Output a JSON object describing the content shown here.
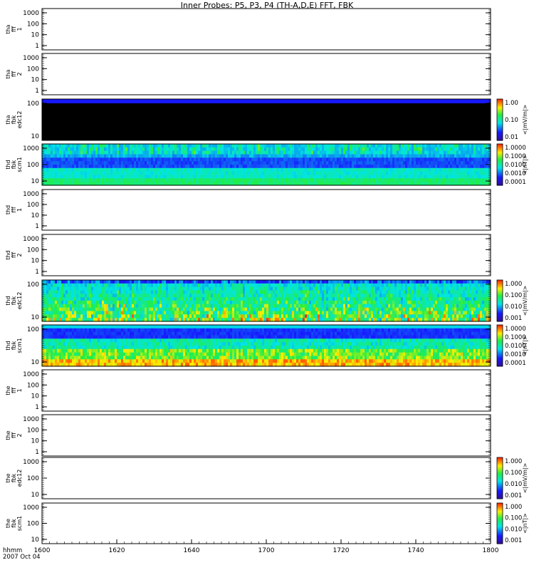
{
  "page": {
    "title": "Inner Probes: P5, P3, P4 (TH-A,D,E) FFT, FBK",
    "time_label": "hhmm",
    "date_label": "2007 Oct 04"
  },
  "colors": {
    "low": "#1818ff",
    "mid": "#00e5e5",
    "midhigh": "#22ee44",
    "high": "#ffee00",
    "peak": "#ff2a00",
    "black": "#000000"
  },
  "chart_data": [
    {
      "type": "heatmap",
      "ylabel": [
        "tha",
        "fff",
        "1"
      ],
      "yticks": [
        "1000",
        "100",
        "10",
        "1"
      ],
      "yscale": "log",
      "state": "empty"
    },
    {
      "type": "heatmap",
      "ylabel": [
        "tha",
        "fff",
        "2"
      ],
      "yticks": [
        "1000",
        "100",
        "10",
        "1"
      ],
      "yscale": "log",
      "state": "empty"
    },
    {
      "type": "heatmap",
      "ylabel": [
        "tha",
        "fbk",
        "edc12"
      ],
      "yticks": [
        "100",
        "10"
      ],
      "yscale": "log",
      "colorbar": {
        "ticks": [
          "1.00",
          "0.10",
          "0.01"
        ],
        "unit": "<|mV/m|>"
      },
      "state": "mostly-black",
      "top_band": "low"
    },
    {
      "type": "heatmap",
      "ylabel": [
        "thd",
        "fbk",
        "scm1"
      ],
      "yticks": [
        "1000",
        "100",
        "10"
      ],
      "yscale": "log",
      "colorbar": {
        "ticks": [
          "1.0000",
          "0.1000",
          "0.0100",
          "0.0010",
          "0.0001"
        ],
        "unit": "<|nT|>"
      },
      "state": "data",
      "profile": "scm-low"
    },
    {
      "type": "heatmap",
      "ylabel": [
        "thd",
        "fff",
        "1"
      ],
      "yticks": [
        "1000",
        "100",
        "10",
        "1"
      ],
      "yscale": "log",
      "state": "empty"
    },
    {
      "type": "heatmap",
      "ylabel": [
        "thd",
        "fff",
        "2"
      ],
      "yticks": [
        "1000",
        "100",
        "10",
        "1"
      ],
      "yscale": "log",
      "state": "empty"
    },
    {
      "type": "heatmap",
      "ylabel": [
        "thd",
        "fbk",
        "edc12"
      ],
      "yticks": [
        "100",
        "10"
      ],
      "yscale": "log",
      "colorbar": {
        "ticks": [
          "1.000",
          "0.100",
          "0.010",
          "0.001"
        ],
        "unit": "<|mV/m|>"
      },
      "state": "data",
      "profile": "edc-high"
    },
    {
      "type": "heatmap",
      "ylabel": [
        "thd",
        "fbk",
        "scm1"
      ],
      "yticks": [
        "100",
        "10"
      ],
      "yscale": "log",
      "colorbar": {
        "ticks": [
          "1.0000",
          "0.1000",
          "0.0100",
          "0.0010",
          "0.0001"
        ],
        "unit": "<|nT|>"
      },
      "state": "data",
      "profile": "scm-high"
    },
    {
      "type": "heatmap",
      "ylabel": [
        "the",
        "fff",
        "1"
      ],
      "yticks": [
        "1000",
        "100",
        "10",
        "1"
      ],
      "yscale": "log",
      "state": "empty"
    },
    {
      "type": "heatmap",
      "ylabel": [
        "the",
        "fff",
        "2"
      ],
      "yticks": [
        "1000",
        "100",
        "10",
        "1"
      ],
      "yscale": "log",
      "state": "empty"
    },
    {
      "type": "heatmap",
      "ylabel": [
        "the",
        "fbk",
        "edc12"
      ],
      "yticks": [
        "1000",
        "100",
        "10"
      ],
      "yscale": "log",
      "colorbar": {
        "ticks": [
          "1.000",
          "0.100",
          "0.010",
          "0.001"
        ],
        "unit": "<|mV/m|>"
      },
      "state": "empty"
    },
    {
      "type": "heatmap",
      "ylabel": [
        "the",
        "fbk",
        "scm1"
      ],
      "yticks": [
        "1000",
        "100",
        "10"
      ],
      "yscale": "log",
      "colorbar": {
        "ticks": [
          "1.000",
          "0.100",
          "0.010",
          "0.001"
        ],
        "unit": "<|nT|>"
      },
      "state": "empty"
    }
  ],
  "x_axis": {
    "ticks": [
      "1600",
      "1620",
      "1640",
      "1700",
      "1720",
      "1740",
      "1800"
    ]
  }
}
